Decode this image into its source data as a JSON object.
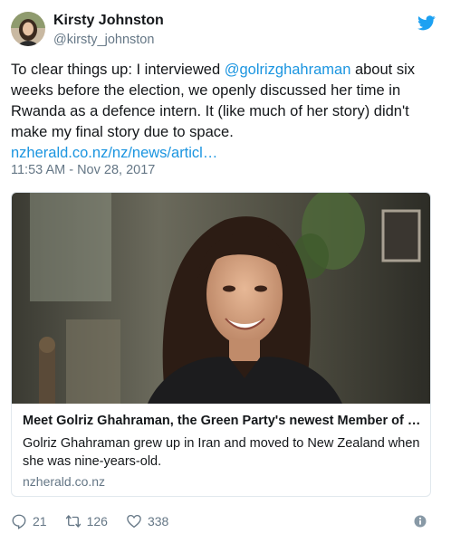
{
  "author": {
    "name": "Kirsty Johnston",
    "handle": "@kirsty_johnston"
  },
  "tweet": {
    "text_before": "To clear things up: I interviewed ",
    "mention": "@golrizghahraman",
    "text_after": " about six weeks before the election, we openly discussed her time in Rwanda as a defence intern. It (like much of her story) didn't make my final story due to space.",
    "link": "nzherald.co.nz/nz/news/articl…",
    "timestamp": "11:53 AM - Nov 28, 2017"
  },
  "card": {
    "title": "Meet Golriz Ghahraman, the Green Party's newest Member of …",
    "description": "Golriz Ghahraman grew up in Iran and moved to New Zealand when she was nine-years-old.",
    "domain": "nzherald.co.nz"
  },
  "actions": {
    "replies": "21",
    "retweets": "126",
    "likes": "338"
  },
  "icons": {
    "brand": "twitter-bird-icon",
    "reply": "reply-icon",
    "retweet": "retweet-icon",
    "like": "heart-icon",
    "info": "info-icon"
  },
  "colors": {
    "link": "#1b95e0",
    "brand": "#1da1f2",
    "muted": "#657786",
    "border": "#e1e8ed"
  }
}
